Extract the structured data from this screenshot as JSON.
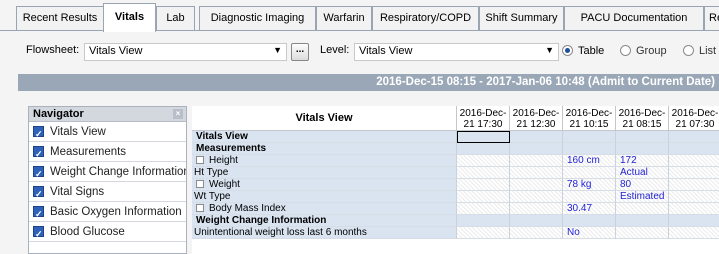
{
  "tabs": [
    "Recent Results",
    "Vitals",
    "Lab",
    "Diagnostic Imaging",
    "Warfarin",
    "Respiratory/COPD",
    "Shift Summary",
    "PACU Documentation",
    "Re"
  ],
  "active_tab": "Vitals",
  "toolbar": {
    "flowsheet_label": "Flowsheet:",
    "flowsheet_value": "Vitals View",
    "ellipsis": "...",
    "level_label": "Level:",
    "level_value": "Vitals View",
    "view_options": [
      {
        "label": "Table",
        "selected": true
      },
      {
        "label": "Group",
        "selected": false
      },
      {
        "label": "List",
        "selected": false
      }
    ]
  },
  "date_range": "2016-Dec-15 08:15 - 2017-Jan-06 10:48 (Admit to Current Date)",
  "navigator": {
    "title": "Navigator",
    "close": "×",
    "items": [
      "Vitals View",
      "Measurements",
      "Weight Change Information",
      "Vital Signs",
      "Basic Oxygen Information",
      "Blood Glucose"
    ]
  },
  "grid": {
    "title": "Vitals View",
    "columns": [
      {
        "date": "2016-Dec-",
        "time": "21 17:30"
      },
      {
        "date": "2016-Dec-",
        "time": "21 12:30"
      },
      {
        "date": "2016-Dec-",
        "time": "21 10:15"
      },
      {
        "date": "2016-Dec-",
        "time": "21 08:15"
      },
      {
        "date": "2016-Dec-",
        "time": "21 07:30"
      }
    ],
    "rows": [
      {
        "label": "Vitals View",
        "type": "header",
        "values": [
          "",
          "",
          "",
          "",
          ""
        ]
      },
      {
        "label": "Measurements",
        "type": "header",
        "values": [
          "",
          "",
          "",
          "",
          ""
        ]
      },
      {
        "label": "Height",
        "type": "item",
        "values": [
          "",
          "",
          "160 cm",
          "172",
          ""
        ]
      },
      {
        "label": "Ht Type",
        "type": "sub",
        "values": [
          "",
          "",
          "",
          "Actual",
          ""
        ]
      },
      {
        "label": "Weight",
        "type": "item",
        "values": [
          "",
          "",
          "78 kg",
          "80",
          ""
        ]
      },
      {
        "label": "Wt Type",
        "type": "sub",
        "values": [
          "",
          "",
          "",
          "Estimated",
          ""
        ]
      },
      {
        "label": "Body Mass Index",
        "type": "item",
        "values": [
          "",
          "",
          "30.47",
          "",
          ""
        ]
      },
      {
        "label": "Weight Change Information",
        "type": "header",
        "values": [
          "",
          "",
          "",
          "",
          ""
        ]
      },
      {
        "label": "Unintentional weight loss last 6 months",
        "type": "sub",
        "values": [
          "",
          "",
          "No",
          "",
          ""
        ]
      }
    ]
  }
}
